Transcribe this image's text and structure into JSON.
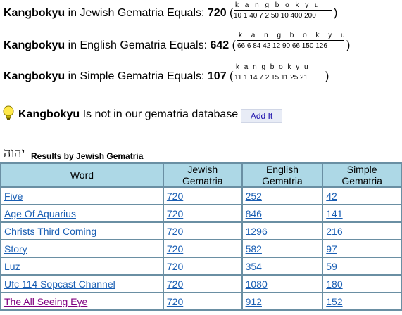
{
  "equations": [
    {
      "word": "Kangbokyu",
      "label": "in Jewish Gematria Equals:",
      "value": "720",
      "letters": "k  a  n  g  b  o  k  y  u",
      "numbers": "10 1 40 7 2 50 10 400 200"
    },
    {
      "word": "Kangbokyu",
      "label": "in English Gematria Equals:",
      "value": "642",
      "letters": "k  a  n  g  b  o  k  y  u",
      "numbers": "66 6 84 42 12 90 66 150 126"
    },
    {
      "word": "Kangbokyu",
      "label": "in Simple Gematria Equals:",
      "value": "107",
      "letters": "k  a  n  g  b  o  k  y  u",
      "numbers": "11 1 14 7 2 15 11 25 21"
    }
  ],
  "notice": {
    "word": "Kangbokyu",
    "text": "Is not in our gematria database",
    "add_button": "Add It"
  },
  "results": {
    "hebrew_logo": "יהוה",
    "title": "Results by Jewish Gematria",
    "headers": [
      "Word",
      "Jewish Gematria",
      "English Gematria",
      "Simple Gematria"
    ],
    "rows": [
      {
        "word": "Five",
        "jewish": "720",
        "english": "252",
        "simple": "42"
      },
      {
        "word": "Age Of Aquarius",
        "jewish": "720",
        "english": "846",
        "simple": "141"
      },
      {
        "word": "Christs Third Coming",
        "jewish": "720",
        "english": "1296",
        "simple": "216"
      },
      {
        "word": "Story",
        "jewish": "720",
        "english": "582",
        "simple": "97"
      },
      {
        "word": "Luz",
        "jewish": "720",
        "english": "354",
        "simple": "59"
      },
      {
        "word": "Ufc 114 Sopcast Channel",
        "jewish": "720",
        "english": "1080",
        "simple": "180"
      },
      {
        "word": "The All Seeing Eye",
        "jewish": "720",
        "english": "912",
        "simple": "152"
      }
    ]
  },
  "colors": {
    "header_bg": "#add8e6",
    "link": "#1a5fb4",
    "visited_link": "#800080"
  }
}
